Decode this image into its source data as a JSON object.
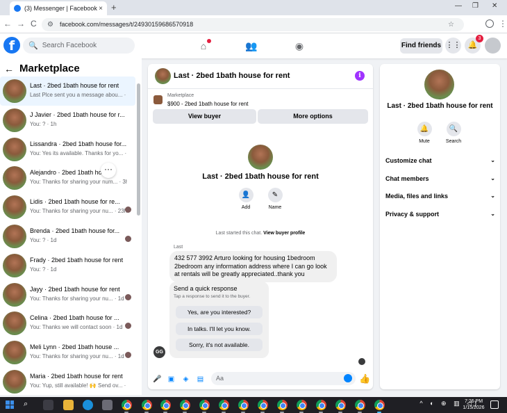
{
  "browser": {
    "tab_title": "(3) Messenger | Facebook",
    "new_tab": "+",
    "url": "facebook.com/messages/t/24930159686570918",
    "back": "←",
    "forward": "→",
    "reload": "C",
    "tab_close": "×"
  },
  "fb_header": {
    "search_placeholder": "Search Facebook",
    "find_friends": "Find friends",
    "notifications_count": "3"
  },
  "left": {
    "title": "Marketplace",
    "conversations": [
      {
        "name": "Last · 2bed 1bath house for rent",
        "preview": "Last Plce sent you a message abou... · 5m",
        "active": true
      },
      {
        "name": "J Javier · 2bed 1bath house for r...",
        "preview": "You: ? · 1h"
      },
      {
        "name": "Lissandra · 2bed 1bath house for...",
        "preview": "You: Yes its available. Thanks for yo... · 2h"
      },
      {
        "name": "Alejandro · 2bed 1bath house",
        "preview": "You: Thanks for sharing your num... · 3h"
      },
      {
        "name": "Lidis · 2bed 1bath house for re...",
        "preview": "You: Thanks for sharing your nu... · 23h"
      },
      {
        "name": "Brenda · 2bed 1bath house for...",
        "preview": "You: ? · 1d"
      },
      {
        "name": "Frady · 2bed 1bath house for rent",
        "preview": "You: ? · 1d"
      },
      {
        "name": "Jayy · 2bed 1bath house for rent",
        "preview": "You: Thanks for sharing your nu... · 1d"
      },
      {
        "name": "Celina · 2bed 1bath house for ...",
        "preview": "You: Thanks we will contact soon · 1d"
      },
      {
        "name": "Meli Lynn · 2bed 1bath house ...",
        "preview": "You: Thanks for sharing your nu... · 1d"
      },
      {
        "name": "Maria · 2bed 1bath house for rent",
        "preview": "You: Yup, still available! 🙌 Send ov... · 1d"
      }
    ],
    "more_icon": "···"
  },
  "chat": {
    "title": "Last · 2bed 1bath house for rent",
    "marketplace_label": "Marketplace",
    "listing": "$900 - 2bed 1bath house for rent",
    "view_buyer": "View buyer",
    "more_options": "More options",
    "hero_title": "Last · 2bed 1bath house for rent",
    "add_label": "Add",
    "name_label": "Name",
    "started_text": "Last started this chat.",
    "view_profile": "View buyer profile",
    "sender": "Last",
    "message": "432 577 3992 Arturo looking for housing 1bedroom 2bedroom any information address where I can go look at rentals will be greatly appreciated..thank you",
    "quick_title": "Send a quick response",
    "quick_sub": "Tap a response to send it to the buyer.",
    "quick_options": [
      "Yes, are you interested?",
      "In talks. I'll let you know.",
      "Sorry, it's not available."
    ],
    "avatar_initials": "GG",
    "input_placeholder": "Aa"
  },
  "right": {
    "title": "Last · 2bed 1bath house for rent",
    "mute": "Mute",
    "search": "Search",
    "rows": [
      "Customize chat",
      "Chat members",
      "Media, files and links",
      "Privacy & support"
    ]
  },
  "taskbar": {
    "time": "7:26 PM",
    "date": "1/15/2026"
  },
  "colors": {
    "fb_blue": "#1877f2",
    "messenger_blue": "#0084ff",
    "info_purple": "#a033ff",
    "badge_red": "#e41e3f"
  }
}
